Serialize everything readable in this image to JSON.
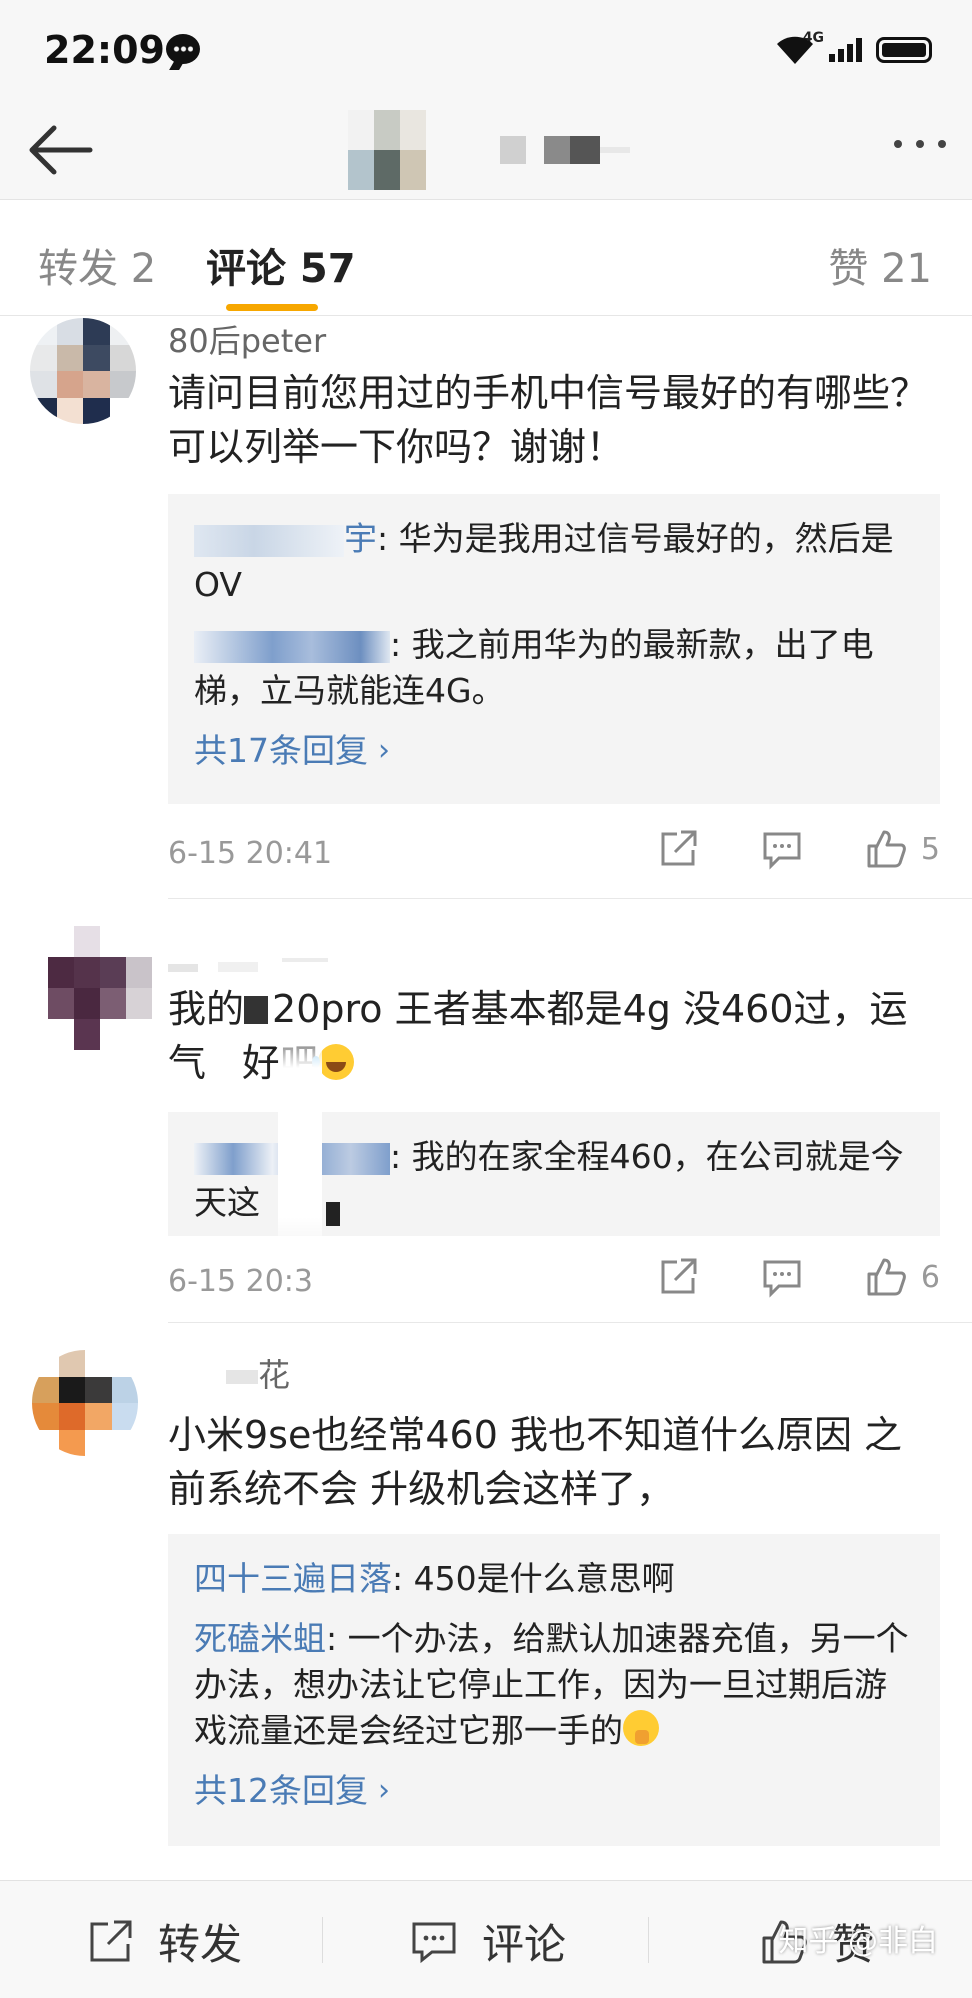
{
  "status_bar": {
    "time": "22:09",
    "network": "4G"
  },
  "header": {
    "title_hidden": true
  },
  "tabs": {
    "repost": "转发 2",
    "comment": "评论 57",
    "like": "赞 21",
    "accent_color": "#f7a700"
  },
  "comments": [
    {
      "username": "80后peter",
      "content": "请问目前您用过的手机中信号最好的有哪些？可以列举一下你吗？谢谢！",
      "replies": [
        {
          "name_suffix": "宇",
          "text": ": 华为是我用过信号最好的，然后是OV"
        },
        {
          "name_suffix": "",
          "text": ": 我之前用华为的最新款，出了电梯，立马就能连4G。"
        }
      ],
      "more_replies": "共17条回复",
      "time": "6-15 20:41",
      "likes": "5"
    },
    {
      "username": "",
      "content_a": "我的",
      "content_b": "20pro  王者基本都是4g     没460过，运气",
      "content_c": "好吧",
      "replies": [
        {
          "text": ": 我的在家全程460，在公司就是今天这"
        }
      ],
      "time": "6-15 20:3",
      "likes": "6"
    },
    {
      "username_suffix": "花",
      "content": "小米9se也经常460 我也不知道什么原因 之前系统不会 升级机会这样了，",
      "replies": [
        {
          "name": "四十三遍日落",
          "text": ": 450是什么意思啊"
        },
        {
          "name": "死磕米蛆",
          "text": ": 一个办法，给默认加速器充值，另一个办法，想办法让它停止工作，因为一旦过期后游戏流量还是会经过它那一手的"
        }
      ],
      "more_replies": "共12条回复"
    }
  ],
  "bottom_bar": {
    "repost": "转发",
    "comment": "评论",
    "like": "赞"
  },
  "watermark": "知乎 @非白",
  "link_color": "#4a7bb5"
}
